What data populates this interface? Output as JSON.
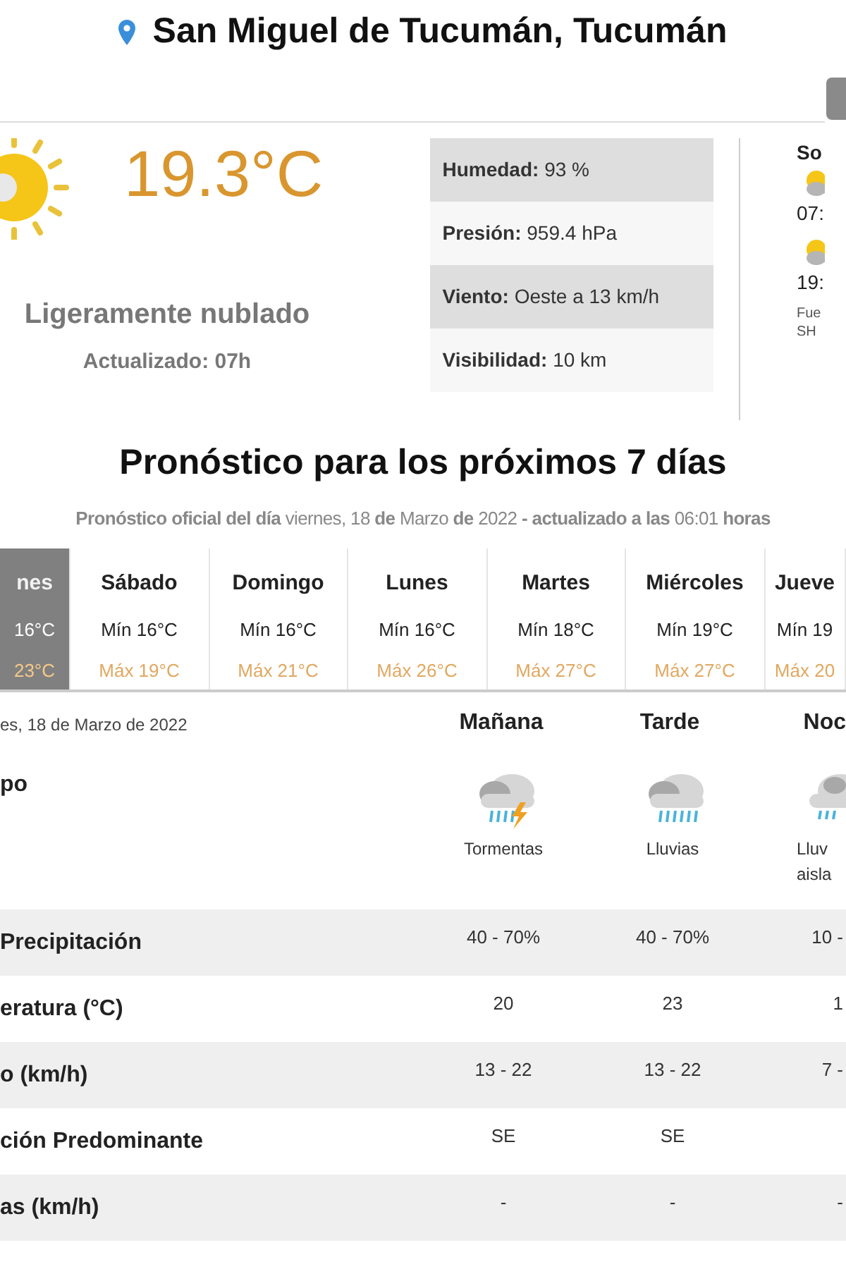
{
  "location": {
    "title": "San Miguel de Tucumán, Tucumán"
  },
  "current": {
    "temperature": "19.3°C",
    "condition": "Ligeramente nublado",
    "updated": "Actualizado: 07h",
    "details": [
      {
        "label": "Humedad:",
        "value": "93 %"
      },
      {
        "label": "Presión:",
        "value": "959.4 hPa"
      },
      {
        "label": "Viento:",
        "value": "Oeste a 13 km/h"
      },
      {
        "label": "Visibilidad:",
        "value": "10 km"
      }
    ]
  },
  "sun_panel": {
    "heading": "So",
    "sunrise": "07:",
    "sunset": "19:",
    "source": [
      "Fue",
      "SH"
    ]
  },
  "forecast": {
    "title": "Pronóstico para los próximos 7 días",
    "subtitle": "**Pronóstico oficial del día** viernes, 18 **de** Marzo **de** 2022 **- actualizado a las** 06:01 **horas**",
    "days": [
      {
        "name": "nes",
        "min": "16°C",
        "max": "23°C",
        "selected": true
      },
      {
        "name": "Sábado",
        "min": "Mín 16°C",
        "max": "Máx 19°C",
        "selected": false
      },
      {
        "name": "Domingo",
        "min": "Mín 16°C",
        "max": "Máx 21°C",
        "selected": false
      },
      {
        "name": "Lunes",
        "min": "Mín 16°C",
        "max": "Máx 26°C",
        "selected": false
      },
      {
        "name": "Martes",
        "min": "Mín 18°C",
        "max": "Máx 27°C",
        "selected": false
      },
      {
        "name": "Miércoles",
        "min": "Mín 19°C",
        "max": "Máx 27°C",
        "selected": false
      },
      {
        "name": "Jueve",
        "min": "Mín 19",
        "max": "Máx 20",
        "selected": false
      }
    ]
  },
  "detail": {
    "date": "es, 18 de Marzo de 2022",
    "sky_label": "po",
    "periods": [
      {
        "name": "Mañana",
        "kind": "storm",
        "condition": [
          "Tormentas"
        ]
      },
      {
        "name": "Tarde",
        "kind": "rain",
        "condition": [
          "Lluvias"
        ]
      },
      {
        "name": "Noc",
        "kind": "showers",
        "condition": [
          "Lluv",
          "aisla"
        ]
      }
    ],
    "rows": [
      {
        "label": "Precipitación",
        "values": [
          "40 - 70%",
          "40 - 70%",
          "10 -"
        ]
      },
      {
        "label": "eratura (°C)",
        "values": [
          "20",
          "23",
          "1"
        ]
      },
      {
        "label": "o (km/h)",
        "values": [
          "13 - 22",
          "13 - 22",
          "7 -"
        ]
      },
      {
        "label": "ción Predominante",
        "values": [
          "SE",
          "SE"
        ]
      },
      {
        "label": "as (km/h)",
        "values": [
          "-",
          "-",
          "-"
        ]
      }
    ]
  }
}
